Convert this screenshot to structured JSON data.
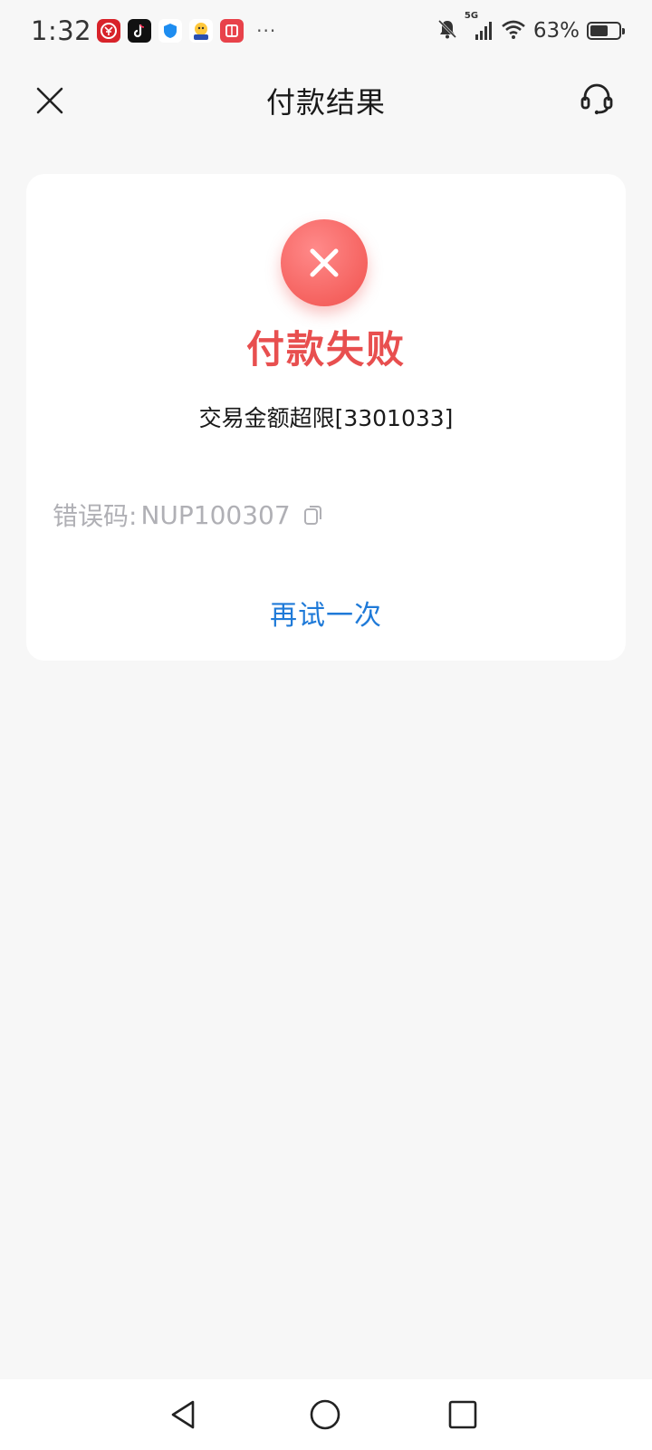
{
  "status_bar": {
    "time": "1:32",
    "more": "···",
    "network": "5G",
    "battery_percent": "63%",
    "battery_level": 0.63
  },
  "header": {
    "title": "付款结果"
  },
  "result": {
    "status_title": "付款失败",
    "reason": "交易金额超限[3301033]",
    "error_label": "错误码:",
    "error_code": "NUP100307",
    "retry_label": "再试一次"
  },
  "colors": {
    "fail_red": "#e84f4f",
    "retry_blue": "#1f7ad8",
    "background": "#f7f7f7"
  }
}
